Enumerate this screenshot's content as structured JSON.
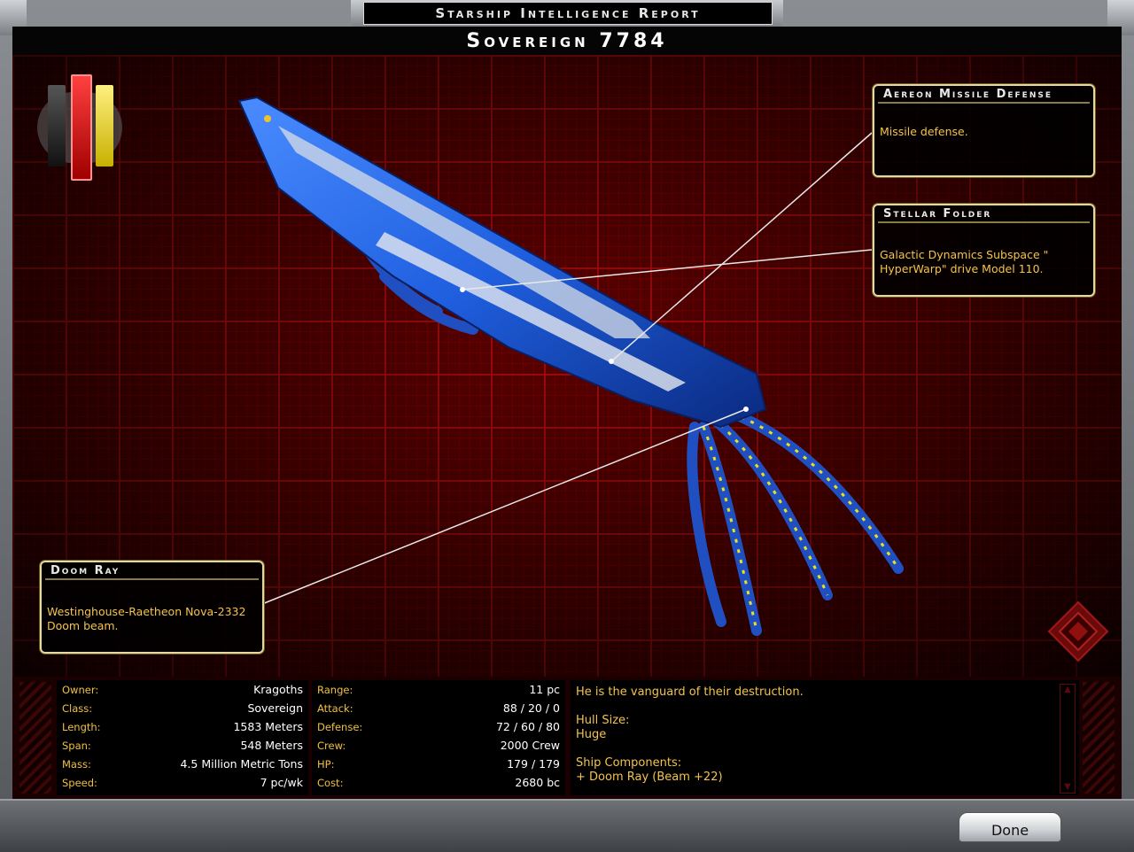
{
  "header": {
    "title": "Starship Intelligence Report",
    "ship_name": "Sovereign 7784"
  },
  "callouts": [
    {
      "id": "missile",
      "title": "Aereon Missile Defense",
      "body": "Missile defense."
    },
    {
      "id": "folder",
      "title": "Stellar Folder",
      "body": "Galactic Dynamics Subspace \" HyperWarp\" drive Model 110."
    },
    {
      "id": "doom",
      "title": "Doom Ray",
      "body": "Westinghouse-Raetheon Nova-2332 Doom beam."
    }
  ],
  "stats_left": [
    {
      "label": "Owner:",
      "value": "Kragoths"
    },
    {
      "label": "Class:",
      "value": "Sovereign"
    },
    {
      "label": "Length:",
      "value": "1583 Meters"
    },
    {
      "label": "Span:",
      "value": "548 Meters"
    },
    {
      "label": "Mass:",
      "value": "4.5 Million Metric Tons"
    },
    {
      "label": "Speed:",
      "value": "7 pc/wk"
    }
  ],
  "stats_mid": [
    {
      "label": "Range:",
      "value": "11 pc"
    },
    {
      "label": "Attack:",
      "value": "88 / 20 / 0"
    },
    {
      "label": "Defense:",
      "value": "72 / 60 / 80"
    },
    {
      "label": "Crew:",
      "value": "2000 Crew"
    },
    {
      "label": "HP:",
      "value": "179 / 179"
    },
    {
      "label": "Cost:",
      "value": "2680 bc"
    }
  ],
  "description": {
    "tagline": "He is the vanguard of their destruction.",
    "hull_label": "Hull Size:",
    "hull_value": "Huge",
    "components_label": "Ship Components:",
    "component_1": "+ Doom Ray (Beam +22)"
  },
  "buttons": {
    "done": "Done"
  },
  "colors": {
    "accent_gold": "#f4c44a",
    "grid_red": "#ff1e1e",
    "ship_blue": "#1f5fe0"
  },
  "icons": {
    "toggle": "view-toggle-icon",
    "rotate": "rotate-view-icon"
  }
}
